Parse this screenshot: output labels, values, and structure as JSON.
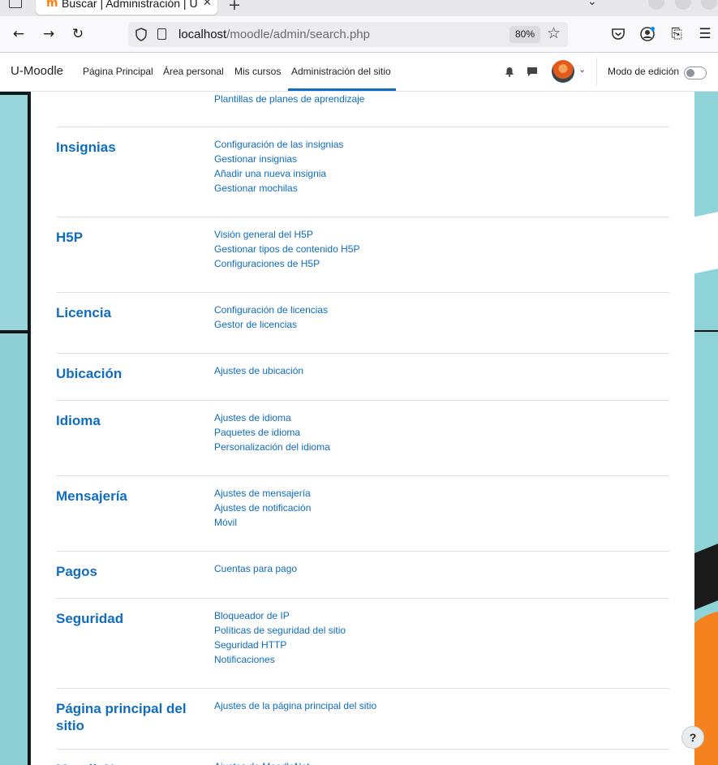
{
  "browser": {
    "tab_title": "Buscar | Administración | U-Moodle",
    "tab_favicon": "m",
    "url_host": "localhost",
    "url_path": "/moodle/admin/search.php",
    "zoom": "80%",
    "icons": [
      "back-icon",
      "forward-icon",
      "reload-icon",
      "shield-icon",
      "page-icon",
      "star-icon",
      "pocket-icon",
      "account-icon",
      "extensions-icon",
      "menu-icon"
    ]
  },
  "navbar": {
    "brand": "U-Moodle",
    "links": [
      "Página Principal",
      "Área personal",
      "Mis cursos",
      "Administración del sitio"
    ],
    "active_link": "Administración del sitio",
    "edit_mode_label": "Modo de edición",
    "edit_mode_on": false
  },
  "colors": {
    "link": "#0f6cbf",
    "accent_bg": "#8dd3d8",
    "orange": "#f5821f"
  },
  "top_partial_link": "Plantillas de planes de aprendizaje",
  "sections": [
    {
      "title": "Insignias",
      "links": [
        "Configuración de las insignias",
        "Gestionar insignias",
        "Añadir una nueva insignia",
        "Gestionar mochilas"
      ]
    },
    {
      "title": "H5P",
      "links": [
        "Visión general del H5P",
        "Gestionar tipos de contenido H5P",
        "Configuraciones de H5P"
      ]
    },
    {
      "title": "Licencia",
      "links": [
        "Configuración de licencias",
        "Gestor de licencias"
      ]
    },
    {
      "title": "Ubicación",
      "links": [
        "Ajustes de ubicación"
      ]
    },
    {
      "title": "Idioma",
      "links": [
        "Ajustes de idioma",
        "Paquetes de idioma",
        "Personalización del idioma"
      ]
    },
    {
      "title": "Mensajería",
      "links": [
        "Ajustes de mensajería",
        "Ajustes de notificación",
        "Móvil"
      ]
    },
    {
      "title": "Pagos",
      "links": [
        "Cuentas para pago"
      ]
    },
    {
      "title": "Seguridad",
      "links": [
        "Bloqueador de IP",
        "Políticas de seguridad del sitio",
        "Seguridad HTTP",
        "Notificaciones"
      ]
    },
    {
      "title": "Página principal del sitio",
      "links": [
        "Ajustes de la página principal del sitio"
      ]
    },
    {
      "title": "MoodleNet",
      "links": [
        "Ajustes de MoodleNet"
      ]
    }
  ],
  "help_button": "?"
}
